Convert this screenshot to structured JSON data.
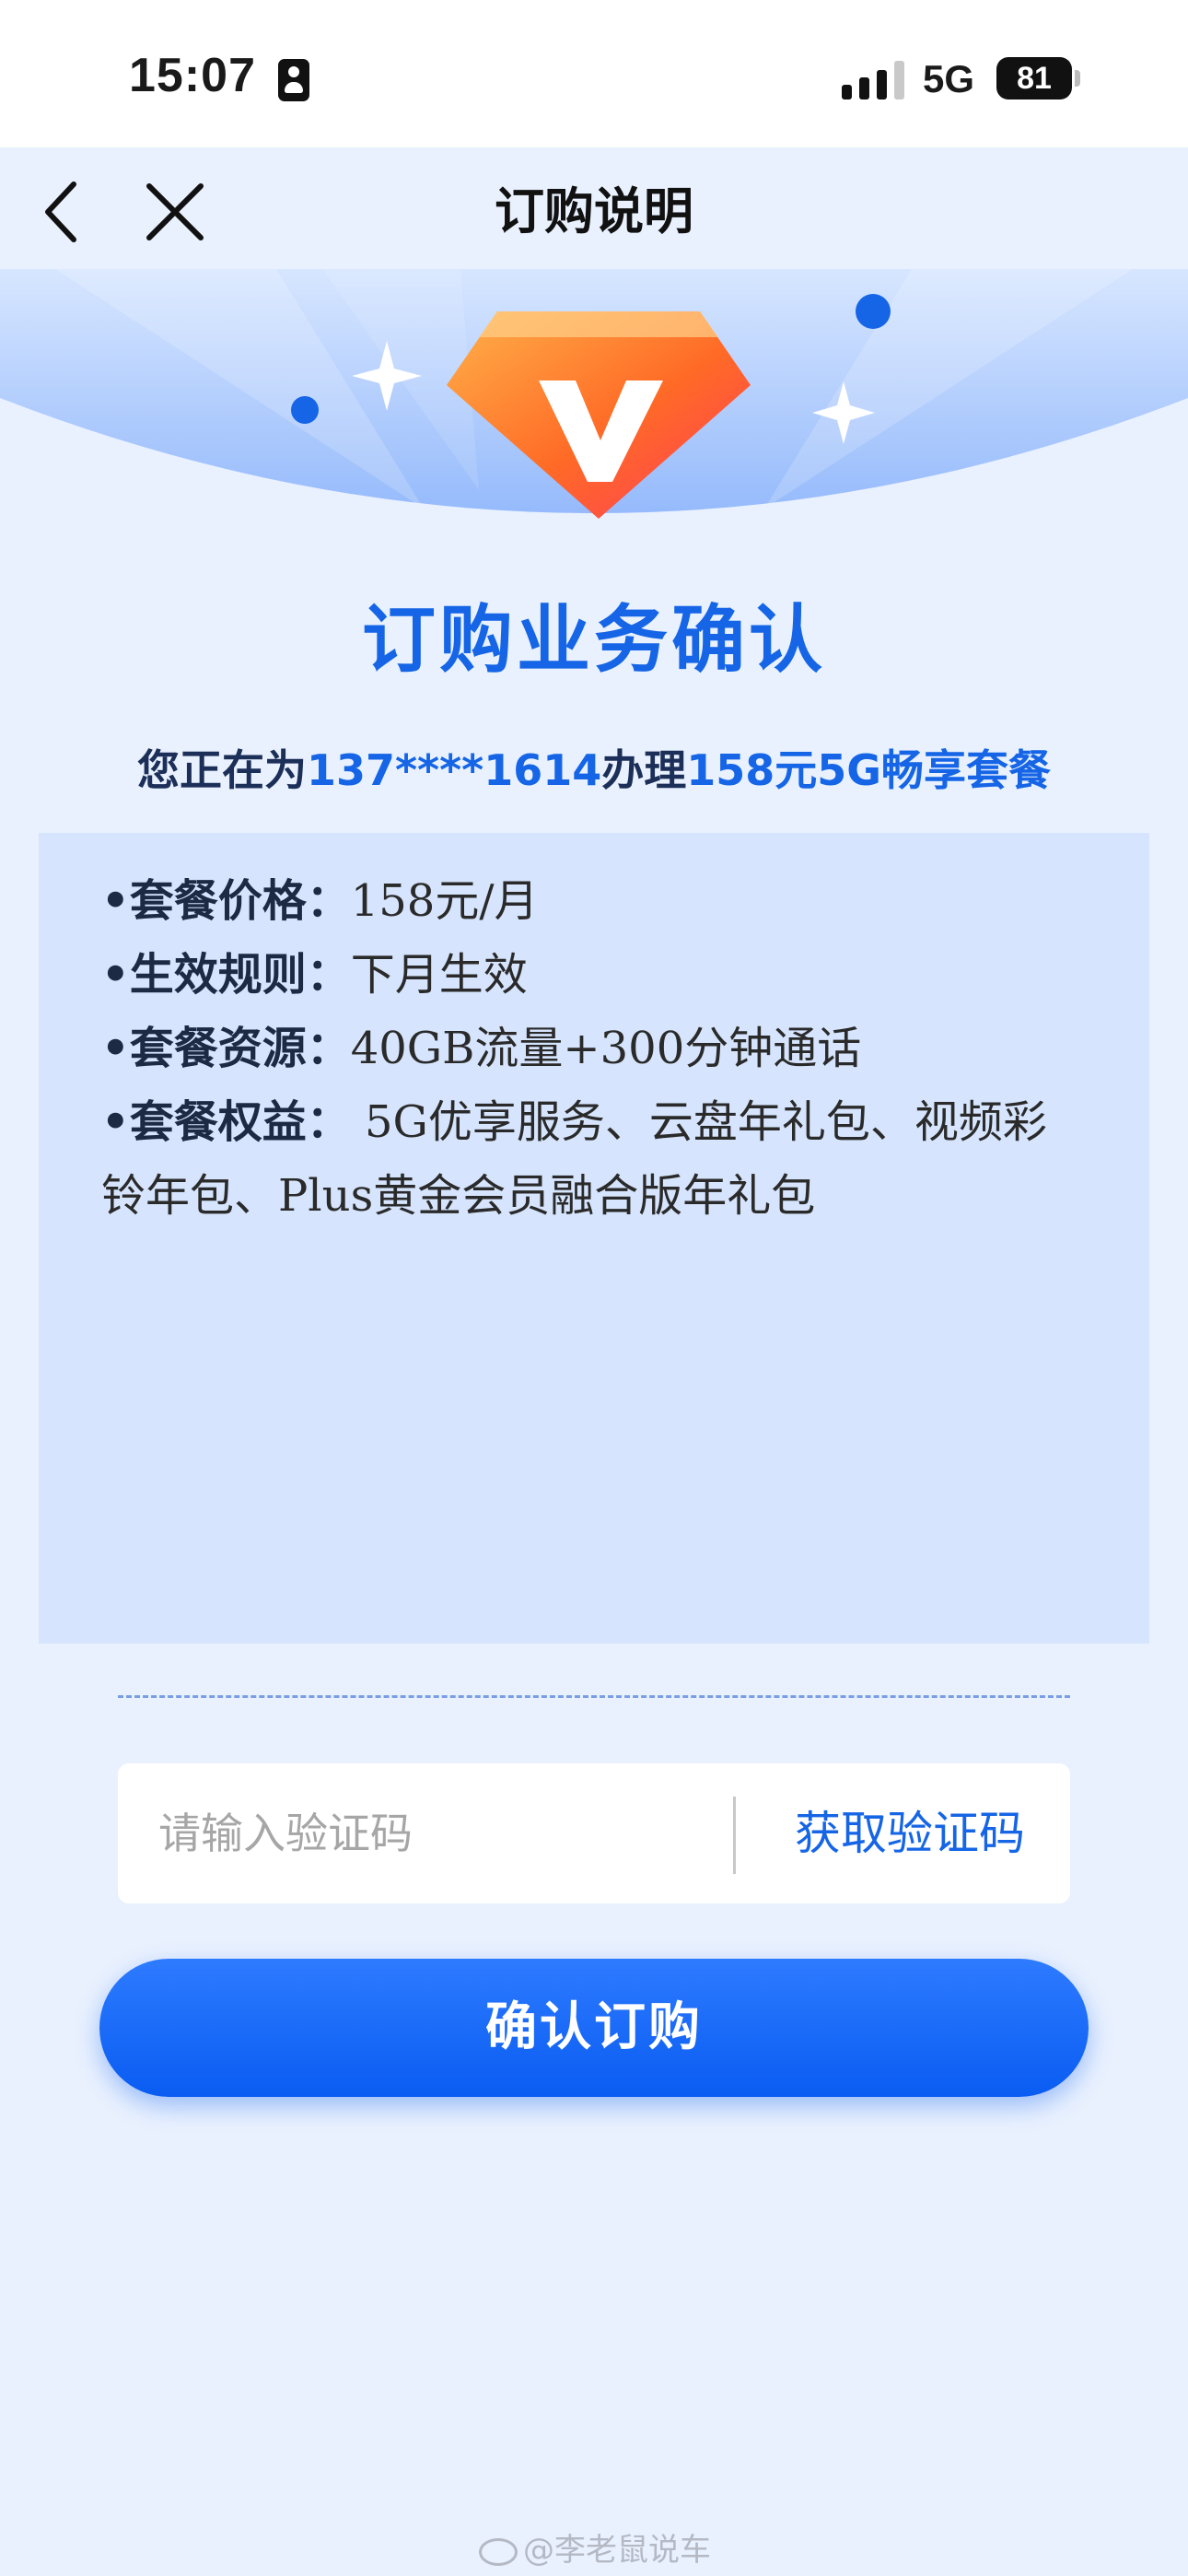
{
  "status_bar": {
    "time": "15:07",
    "network": "5G",
    "battery": "81"
  },
  "nav": {
    "title": "订购说明"
  },
  "heading": "订购业务确认",
  "subtitle": {
    "prefix": "您正在为",
    "phone": "137****1614",
    "middle": "办理",
    "plan": "158元5G畅享套餐"
  },
  "info": {
    "price_label": "套餐价格：",
    "price_value": "158元/月",
    "rule_label": "生效规则：",
    "rule_value": "下月生效",
    "resource_label": "套餐资源：",
    "resource_value": "40GB流量+300分钟通话",
    "benefit_label": "套餐权益：",
    "benefit_value": "5G优享服务、云盘年礼包、视频彩铃年包、Plus黄金会员融合版年礼包"
  },
  "verify": {
    "placeholder": "请输入验证码",
    "get_code_label": "获取验证码"
  },
  "confirm_label": "确认订购",
  "watermark": "@李老鼠说车",
  "colors": {
    "accent": "#1565e6",
    "button": "#0a5cf2",
    "info_bg": "#d6e5fd",
    "page_bg": "#e9f1fe"
  }
}
